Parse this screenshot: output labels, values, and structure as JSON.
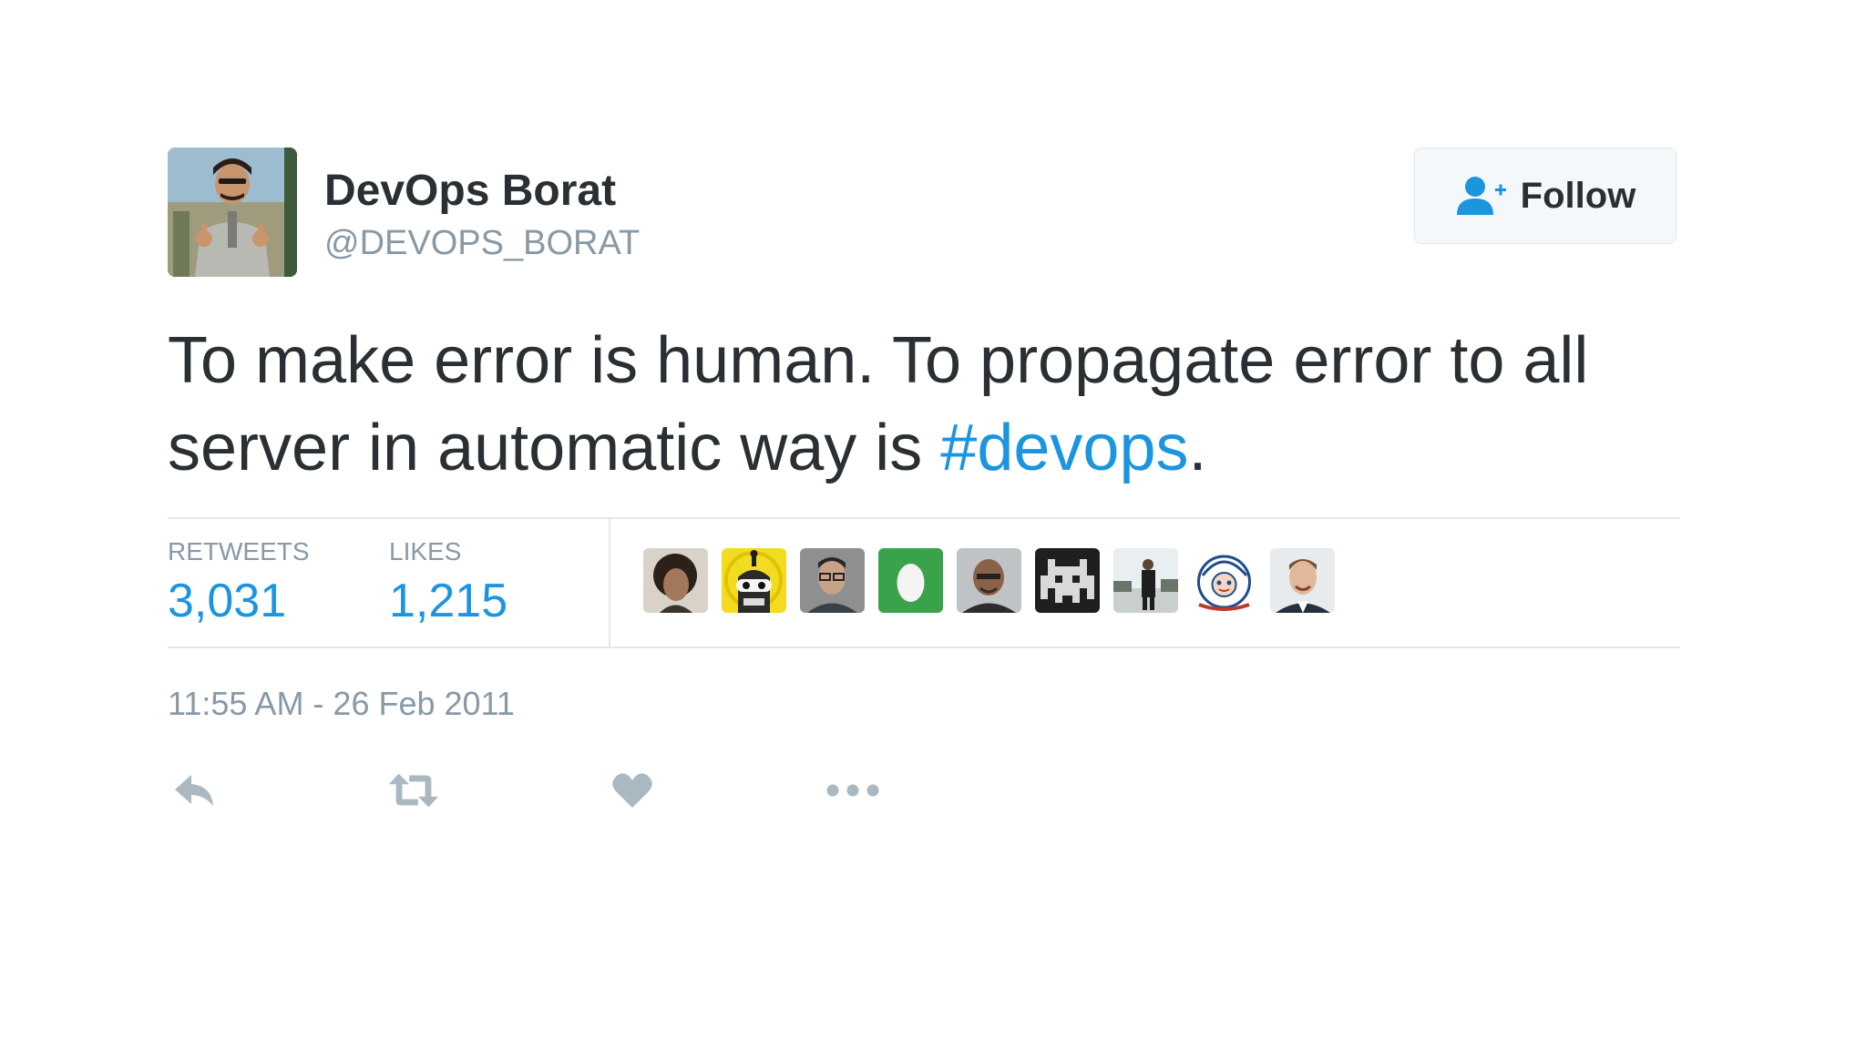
{
  "author": {
    "name": "DevOps Borat",
    "handle": "@DEVOPS_BORAT"
  },
  "follow_button": {
    "label": "Follow",
    "icon": "follow-user-icon"
  },
  "tweet": {
    "text_before": "To make error is human. To propagate error to all server in automatic way is ",
    "hashtag": "#devops",
    "text_after": ".",
    "timestamp": "11:55 AM - 26 Feb 2011"
  },
  "stats": {
    "retweets_label": "RETWEETS",
    "retweets_count": "3,031",
    "likes_label": "LIKES",
    "likes_count": "1,215"
  },
  "likers": [
    {
      "icon": "liker-avatar-curly-hair"
    },
    {
      "icon": "liker-avatar-robot-yellow"
    },
    {
      "icon": "liker-avatar-man-glasses"
    },
    {
      "icon": "liker-avatar-green-egg"
    },
    {
      "icon": "liker-avatar-man-bald"
    },
    {
      "icon": "liker-avatar-pixel-invader"
    },
    {
      "icon": "liker-avatar-person-outdoors"
    },
    {
      "icon": "liker-avatar-cartoon-face"
    },
    {
      "icon": "liker-avatar-man-smiling"
    }
  ],
  "actions": [
    {
      "icon": "reply-icon"
    },
    {
      "icon": "retweet-icon"
    },
    {
      "icon": "like-heart-icon"
    },
    {
      "icon": "more-options-icon"
    }
  ],
  "colors": {
    "accent": "#1b95e0",
    "text": "#292f33",
    "muted": "#8899a6",
    "border": "#e1e8ed"
  }
}
